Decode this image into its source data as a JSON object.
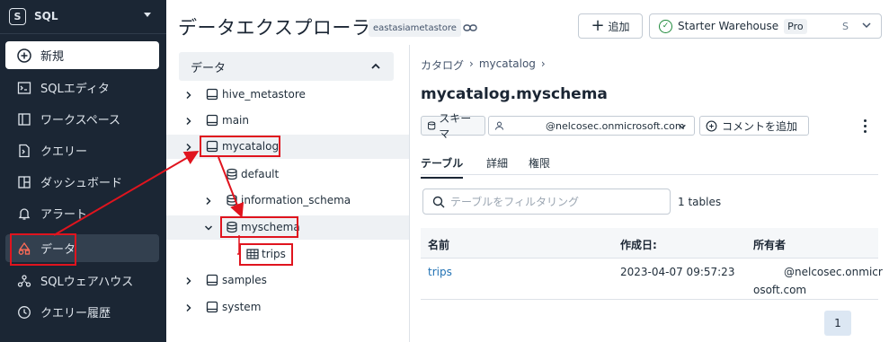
{
  "app": {
    "name": "SQL"
  },
  "sidebar": {
    "items": [
      {
        "label": "新規",
        "icon": "plus-circle-icon"
      },
      {
        "label": "SQLエディタ",
        "icon": "sql-editor-icon"
      },
      {
        "label": "ワークスペース",
        "icon": "workspace-icon"
      },
      {
        "label": "クエリー",
        "icon": "query-icon"
      },
      {
        "label": "ダッシュボード",
        "icon": "dashboard-icon"
      },
      {
        "label": "アラート",
        "icon": "bell-icon"
      },
      {
        "label": "データ",
        "icon": "data-icon"
      },
      {
        "label": "SQLウェアハウス",
        "icon": "warehouse-icon"
      },
      {
        "label": "クエリー履歴",
        "icon": "history-icon"
      }
    ]
  },
  "header": {
    "title": "データエクスプローラ",
    "metastore": "eastasiametastore",
    "add_label": "追加",
    "warehouse": {
      "name": "Starter Warehouse",
      "badge": "Pro",
      "size": "S"
    }
  },
  "tree": {
    "header": "データ",
    "catalogs": {
      "hive_metastore": "hive_metastore",
      "main": "main",
      "mycatalog": "mycatalog",
      "default": "default",
      "information_schema": "information_schema",
      "myschema": "myschema",
      "trips": "trips",
      "samples": "samples",
      "system": "system"
    }
  },
  "main": {
    "breadcrumb": {
      "root": "カタログ",
      "catalog": "mycatalog",
      "sep": "›"
    },
    "schema_title": "mycatalog.myschema",
    "schema_chip": "スキーマ",
    "owner_email": "@nelcosec.onmicrosoft.com",
    "comment_label": "コメントを追加",
    "tabs": [
      "テーブル",
      "詳細",
      "権限"
    ],
    "filter_placeholder": "テーブルをフィルタリング",
    "table_count": "1 tables",
    "columns": {
      "name": "名前",
      "created": "作成日:",
      "owner": "所有者"
    },
    "rows": [
      {
        "name": "trips",
        "created": "2023-04-07 09:57:23",
        "owner_line1": "@nelcosec.onmicr",
        "owner_line2": "osoft.com"
      }
    ],
    "page": "1"
  },
  "colors": {
    "sidebar_bg": "#1b2634",
    "annotation_red": "#e0141e",
    "link_blue": "#2272b4"
  }
}
